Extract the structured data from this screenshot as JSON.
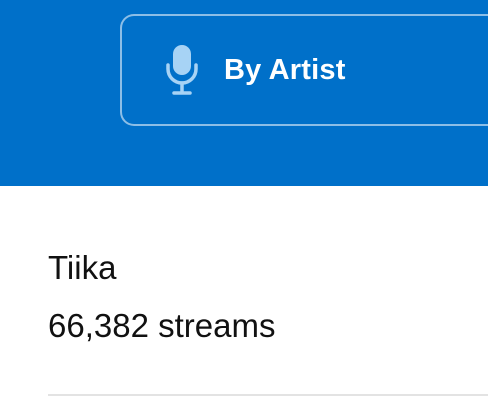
{
  "header": {
    "background_color": "#0070c9",
    "filter_button": {
      "icon": "microphone-icon",
      "label": "By Artist"
    }
  },
  "results": [
    {
      "artist": "Tiika",
      "streams": "66,382 streams"
    }
  ]
}
